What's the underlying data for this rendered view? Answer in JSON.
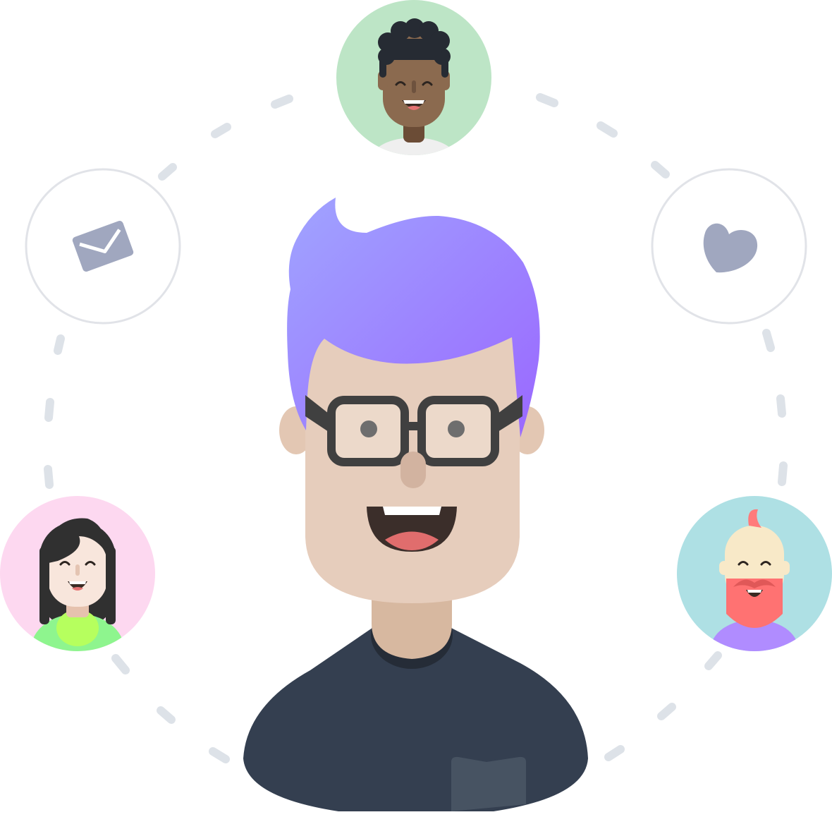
{
  "illustration": {
    "central_avatar": "developer-with-glasses",
    "orbit_nodes": [
      {
        "name": "avatar-curly-hair-man",
        "type": "avatar",
        "background": "#bde5c6"
      },
      {
        "name": "mail",
        "type": "icon",
        "icon": "envelope-icon"
      },
      {
        "name": "heart",
        "type": "icon",
        "icon": "heart-icon"
      },
      {
        "name": "avatar-dark-hair-woman",
        "type": "avatar",
        "background": "#fdd8f0"
      },
      {
        "name": "avatar-bearded-man",
        "type": "avatar",
        "background": "#aee0e4"
      }
    ]
  },
  "colors": {
    "hair_purple": "#9b7bff",
    "skin_light": "#e6cdbc",
    "shirt_dark": "#343f50",
    "dash_gray": "#dde2e8",
    "icon_gray": "#a0a7bf",
    "ring_gray": "#e1e3e8"
  }
}
